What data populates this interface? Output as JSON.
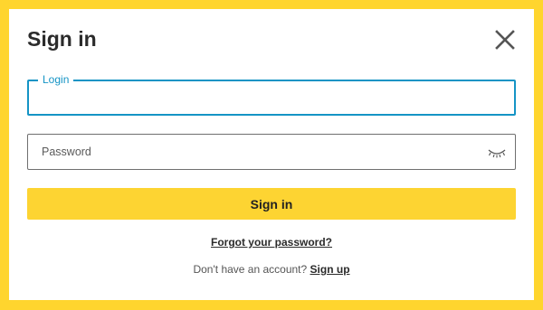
{
  "dialog": {
    "title": "Sign in",
    "close_icon": "close-icon"
  },
  "login": {
    "label": "Login",
    "value": ""
  },
  "password": {
    "placeholder": "Password",
    "value": "",
    "toggle_icon": "eye-closed-icon"
  },
  "actions": {
    "submit_label": "Sign in",
    "forgot_label": "Forgot your password?",
    "no_account_text": "Don't have an account?",
    "signup_label": "Sign up"
  },
  "colors": {
    "accent": "#ffd52e",
    "button": "#fdd432",
    "focus": "#1594c5"
  }
}
